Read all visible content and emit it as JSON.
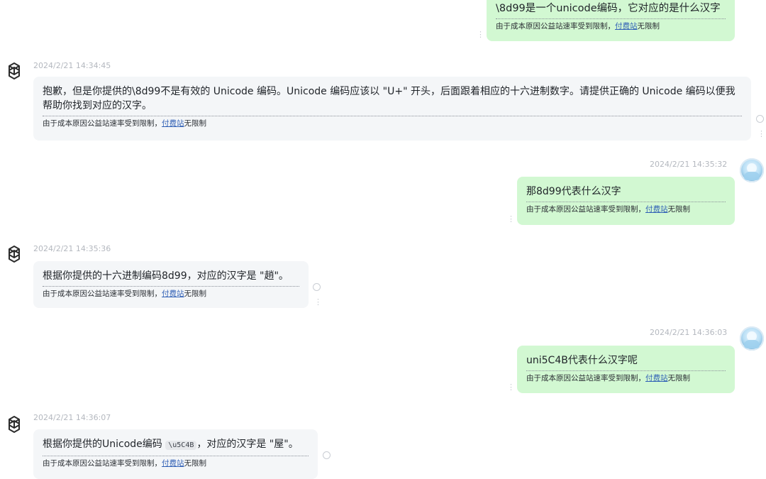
{
  "notice": {
    "prefix": "由于成本原因公益站速率受到限制，",
    "link": "付费站",
    "suffix": "无限制"
  },
  "messages": [
    {
      "role": "user",
      "timestamp": "",
      "text": "\\8d99是一个unicode编码，它对应的是什么汉字"
    },
    {
      "role": "assistant",
      "timestamp": "2024/2/21 14:34:45",
      "text": "抱歉，但是你提供的\\8d99不是有效的 Unicode 编码。Unicode 编码应该以 \"U+\" 开头，后面跟着相应的十六进制数字。请提供正确的 Unicode 编码以便我帮助你找到对应的汉字。"
    },
    {
      "role": "user",
      "timestamp": "2024/2/21 14:35:32",
      "text": "那8d99代表什么汉字"
    },
    {
      "role": "assistant",
      "timestamp": "2024/2/21 14:35:36",
      "text": "根据你提供的十六进制编码8d99，对应的汉字是 \"趙\"。"
    },
    {
      "role": "user",
      "timestamp": "2024/2/21 14:36:03",
      "text": "uni5C4B代表什么汉字呢"
    },
    {
      "role": "assistant",
      "timestamp": "2024/2/21 14:36:07",
      "text_before": "根据你提供的Unicode编码 ",
      "code": "\\u5C4B",
      "text_after": "，对应的汉字是 \"屋\"。"
    }
  ],
  "icons": {
    "ai_avatar": "openai-logo-icon",
    "user_avatar": "anime-avatar-icon",
    "more": "kebab-menu-icon",
    "status": "loading-circle-icon"
  }
}
